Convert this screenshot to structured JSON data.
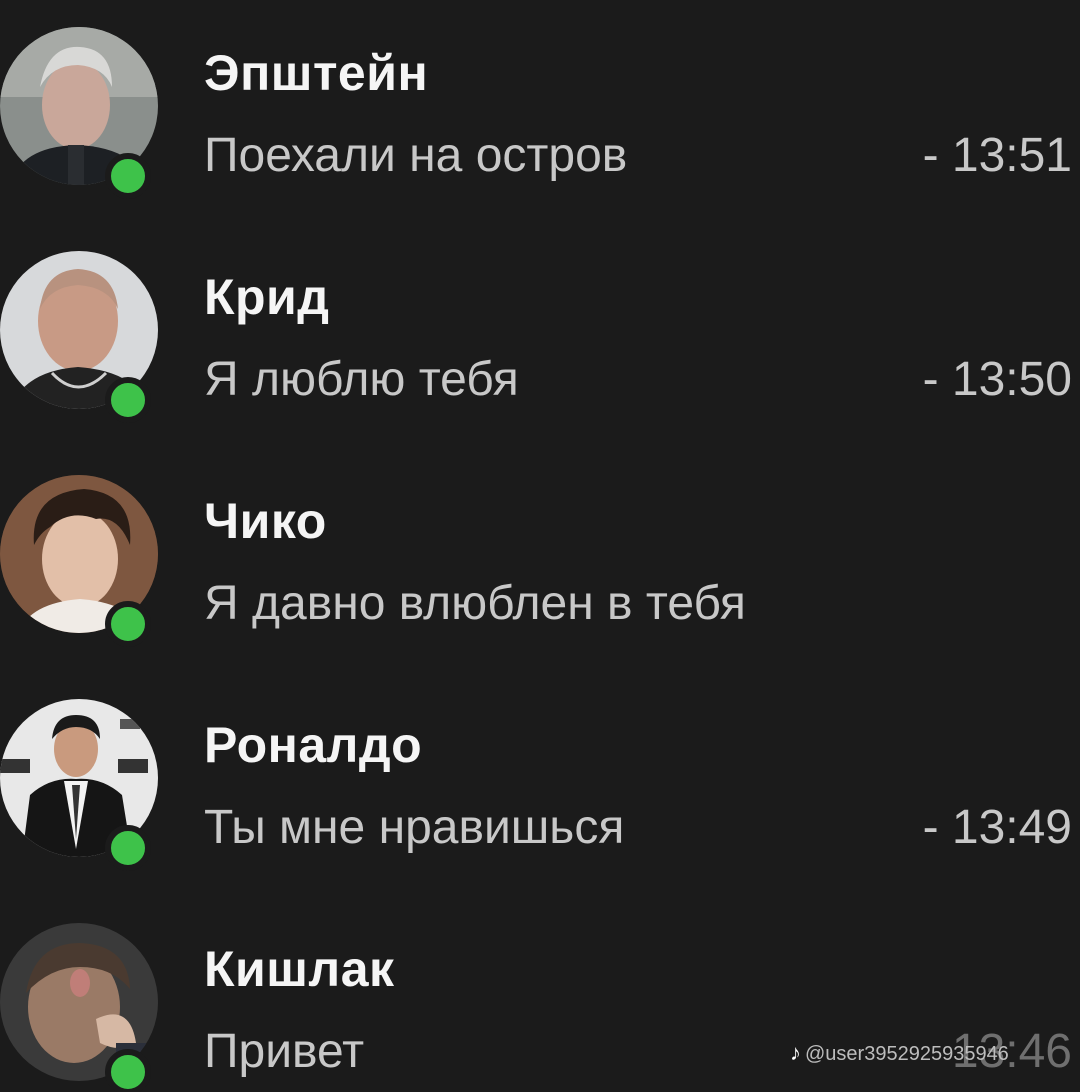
{
  "chats": [
    {
      "name": "Эпштейн",
      "message": "Поехали на остров",
      "time": "- 13:51",
      "online": true
    },
    {
      "name": "Крид",
      "message": "Я люблю тебя",
      "time": "- 13:50",
      "online": true
    },
    {
      "name": "Чико",
      "message": "Я давно влюблен в тебя",
      "time": "",
      "online": true
    },
    {
      "name": "Роналдо",
      "message": "Ты мне нравишься",
      "time": "- 13:49",
      "online": true
    },
    {
      "name": "Кишлак",
      "message": "Привет",
      "time": "13:46",
      "online": true
    }
  ],
  "watermark": {
    "icon": "tiktok-icon",
    "text": "@user3952925935946"
  },
  "colors": {
    "background": "#1b1b1b",
    "online": "#3ec24a",
    "name": "#f5f5f5",
    "secondary": "#c8c8c8"
  }
}
